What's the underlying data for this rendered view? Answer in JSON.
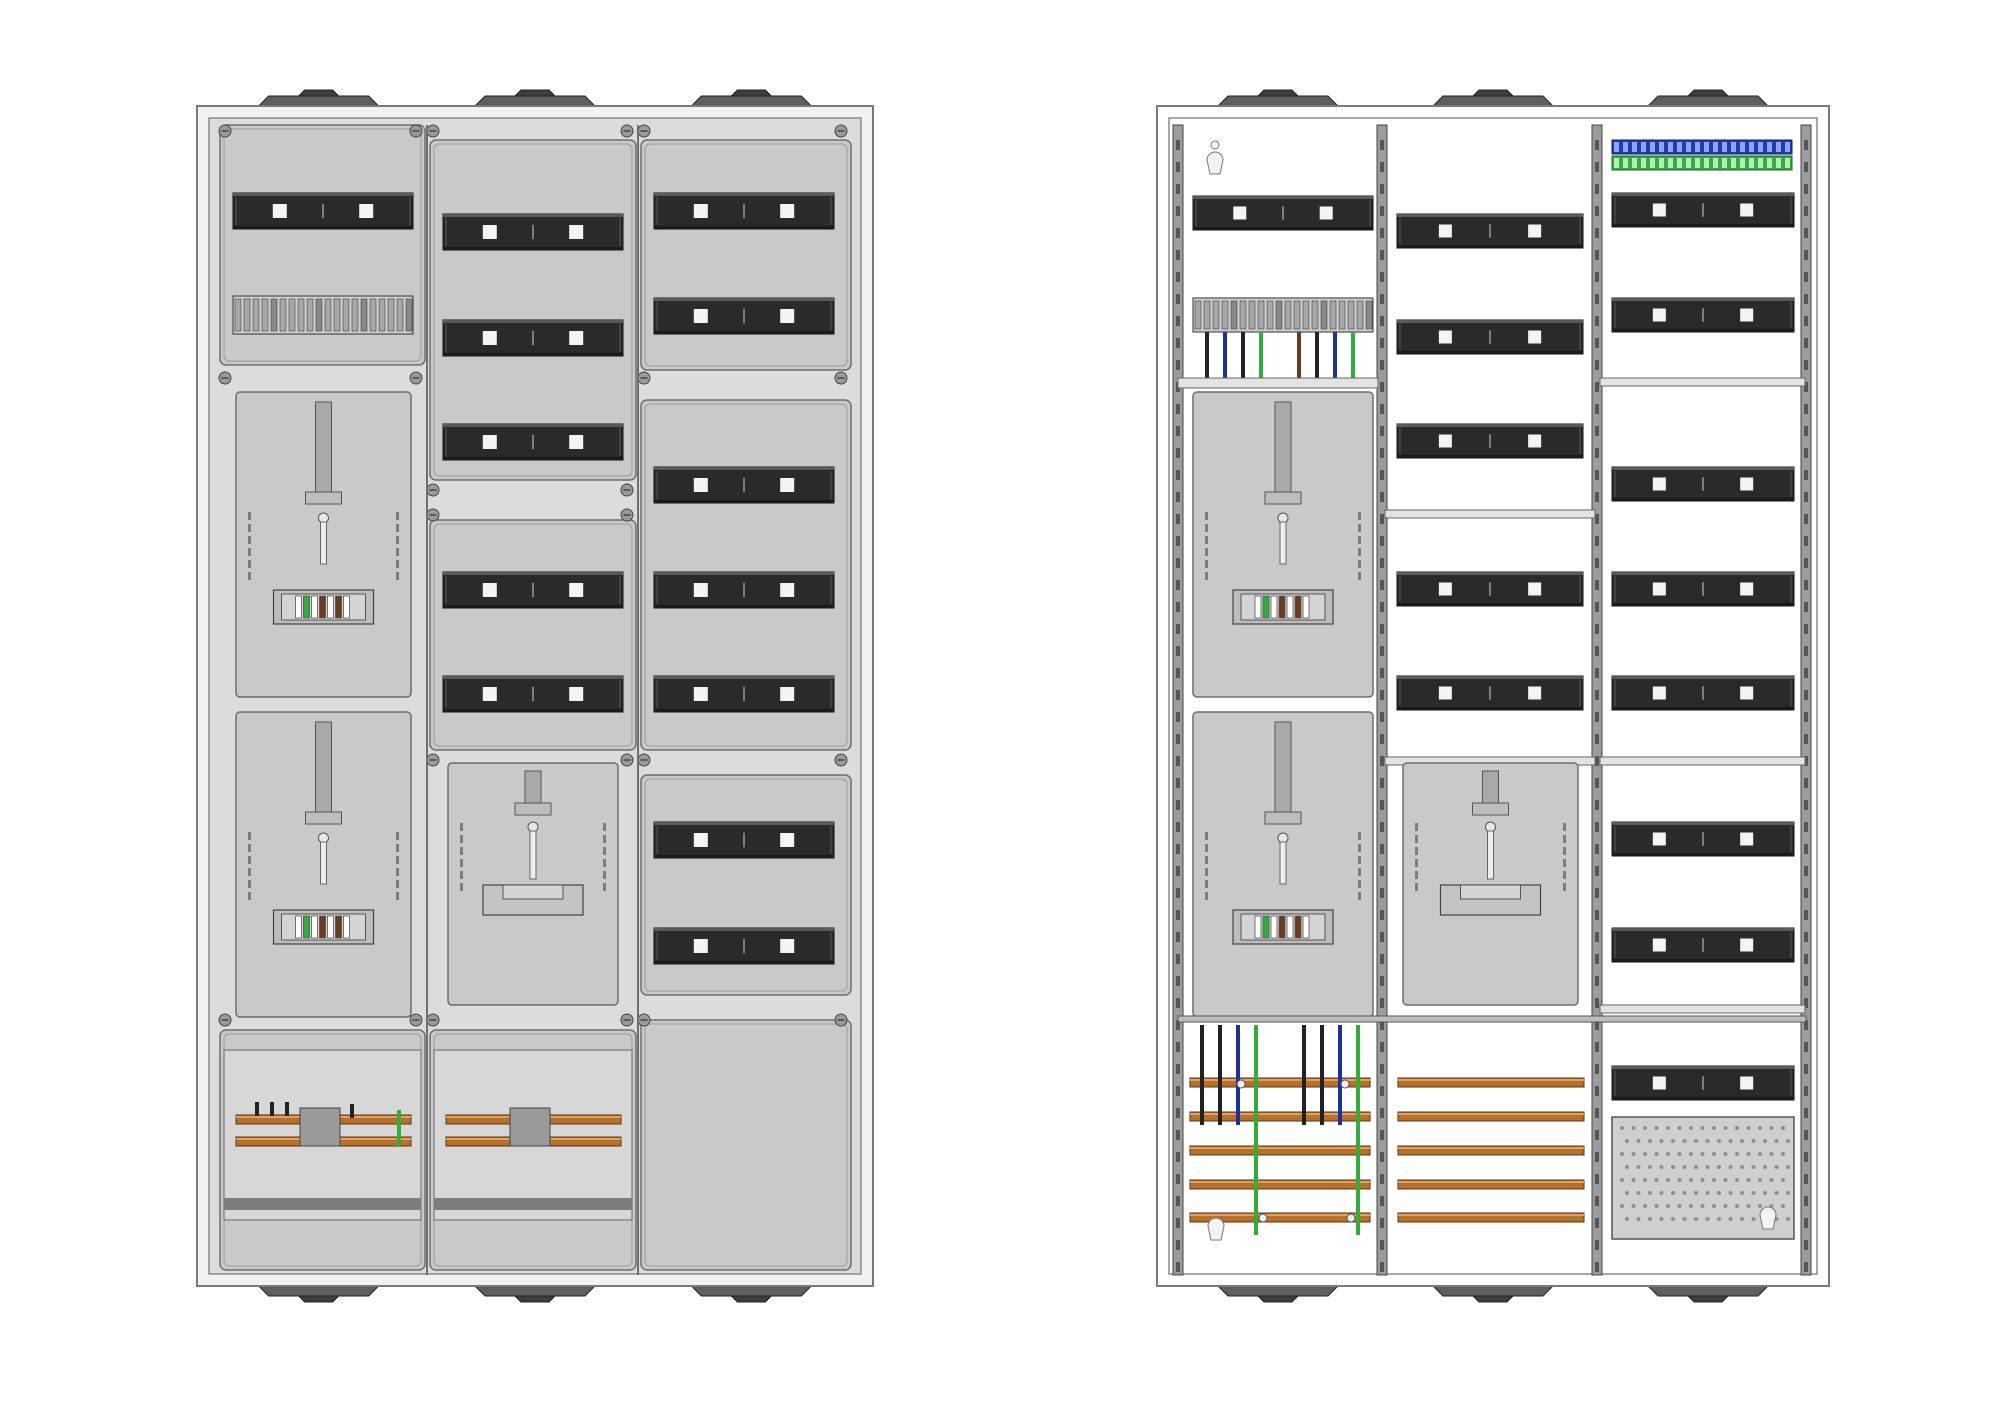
{
  "figure": {
    "type": "technical-drawing",
    "views": [
      {
        "id": "closed",
        "title": ""
      },
      {
        "id": "open",
        "title": ""
      }
    ],
    "palette": {
      "background": "#ffffff",
      "housing": "#f2f2f2",
      "housing_edge": "#7a7a7a",
      "cover": "#c9c9c9",
      "cover_edge": "#6e6e6e",
      "rail": "#2a2a2a",
      "rail_hi": "#5a5a5a",
      "busbar": "#b8712d",
      "busbar_hi": "#e3a15e",
      "wire_green": "#2fae3a",
      "wire_blue": "#1c2ea0",
      "wire_black": "#222222",
      "wire_brown": "#6b3b1f",
      "terminal_blue": "#1f3ea8",
      "terminal_green": "#39a845",
      "grey_panel": "#c4c4c4",
      "perforated": "#cfcfcf"
    }
  }
}
